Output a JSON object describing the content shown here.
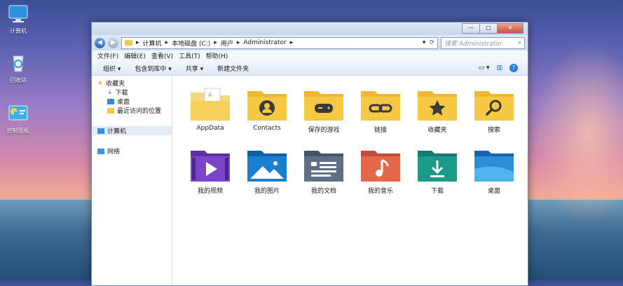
{
  "desktop": {
    "icons": [
      {
        "label": "计算机",
        "icon": "computer-icon"
      },
      {
        "label": "回收站",
        "icon": "recycle-bin-icon"
      },
      {
        "label": "控制面板",
        "icon": "control-panel-icon"
      }
    ]
  },
  "window": {
    "controls": {
      "minimize": "—",
      "maximize": "□",
      "close": "✕"
    },
    "nav": {
      "back": "◀",
      "forward": "▶"
    },
    "breadcrumb": [
      "计算机",
      "本地磁盘 (C:)",
      "用户",
      "Administrator"
    ],
    "search_placeholder": "搜索 Administrator",
    "menu": [
      "文件(F)",
      "编辑(E)",
      "查看(V)",
      "工具(T)",
      "帮助(H)"
    ],
    "toolbar": [
      "组织 ▾",
      "包含到库中 ▾",
      "共享 ▾",
      "新建文件夹"
    ],
    "toolbar_help": "?",
    "sidebar": {
      "favorites": {
        "label": "收藏夹",
        "items": [
          "下载",
          "桌面",
          "最近访问的位置"
        ]
      },
      "computer": "计算机",
      "network": "网络"
    },
    "folders": [
      {
        "label": "AppData",
        "icon": "appdata-folder-icon"
      },
      {
        "label": "Contacts",
        "icon": "contacts-folder-icon"
      },
      {
        "label": "保存的游戏",
        "icon": "saved-games-folder-icon"
      },
      {
        "label": "链接",
        "icon": "links-folder-icon"
      },
      {
        "label": "收藏夹",
        "icon": "favorites-folder-icon"
      },
      {
        "label": "搜索",
        "icon": "search-folder-icon"
      },
      {
        "label": "我的视频",
        "icon": "videos-folder-icon"
      },
      {
        "label": "我的图片",
        "icon": "pictures-folder-icon"
      },
      {
        "label": "我的文档",
        "icon": "documents-folder-icon"
      },
      {
        "label": "我的音乐",
        "icon": "music-folder-icon"
      },
      {
        "label": "下载",
        "icon": "downloads-folder-icon"
      },
      {
        "label": "桌面",
        "icon": "desktop-folder-icon"
      }
    ]
  },
  "colors": {
    "folder_yellow": "#f7c844",
    "accent_blue": "#2f66b8",
    "video_purple": "#7a45c9",
    "pictures_blue": "#1a7fd1",
    "documents_slate": "#5f6f86",
    "music_orange": "#e5674a",
    "downloads_teal": "#1b9a8a",
    "desktop_blue": "#2a8fd8"
  }
}
